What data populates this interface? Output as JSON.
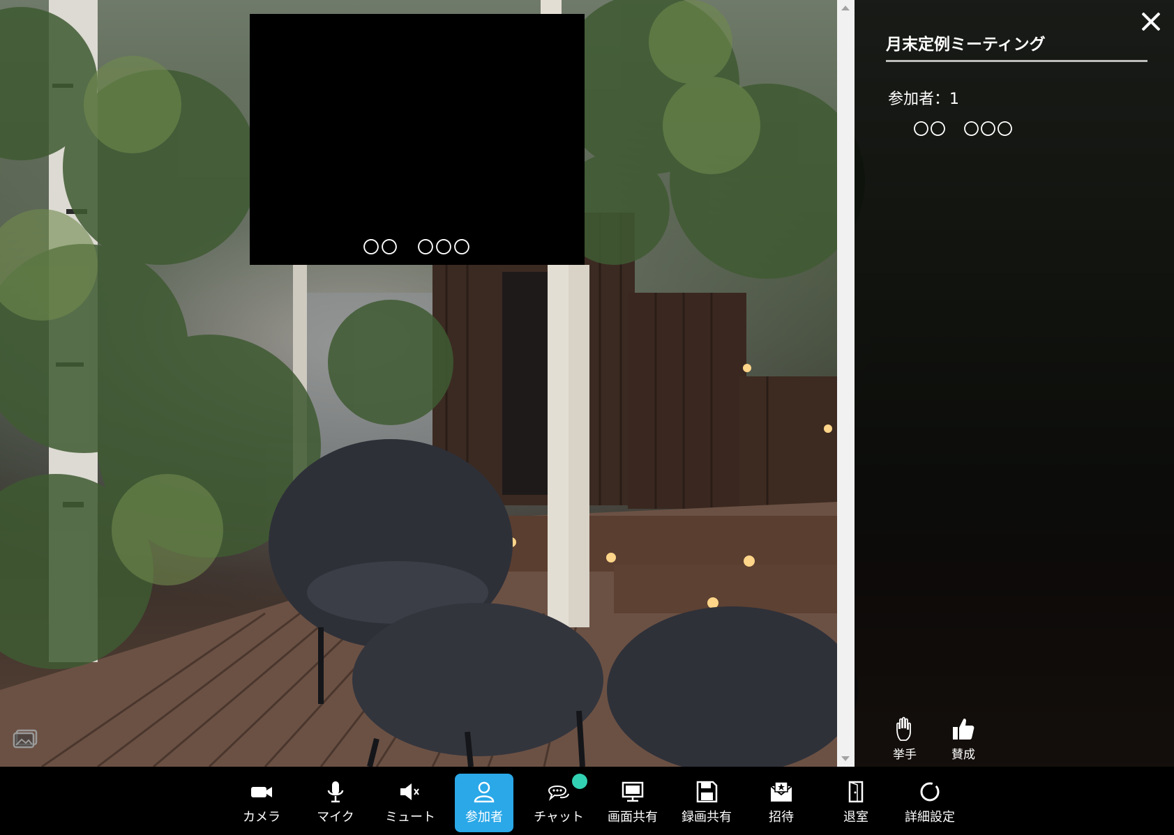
{
  "meeting": {
    "title": "月末定例ミーティング",
    "participants_label": "参加者：1",
    "participant_names": [
      "〇〇　〇〇〇"
    ]
  },
  "self_tile": {
    "name": "〇〇　〇〇〇"
  },
  "reactions": [
    {
      "label": "挙手",
      "icon": "raise-hand-icon"
    },
    {
      "label": "賛成",
      "icon": "thumbs-up-icon"
    }
  ],
  "toolbar": {
    "camera": "カメラ",
    "mic": "マイク",
    "mute": "ミュート",
    "participants": "参加者",
    "chat": "チャット",
    "screen_share": "画面共有",
    "record_share": "録画共有",
    "invite": "招待",
    "leave": "退室",
    "settings": "詳細設定"
  },
  "colors": {
    "active_button": "#2aa8e8",
    "chat_badge": "#33d1b3",
    "toolbar_bg": "#000000"
  }
}
